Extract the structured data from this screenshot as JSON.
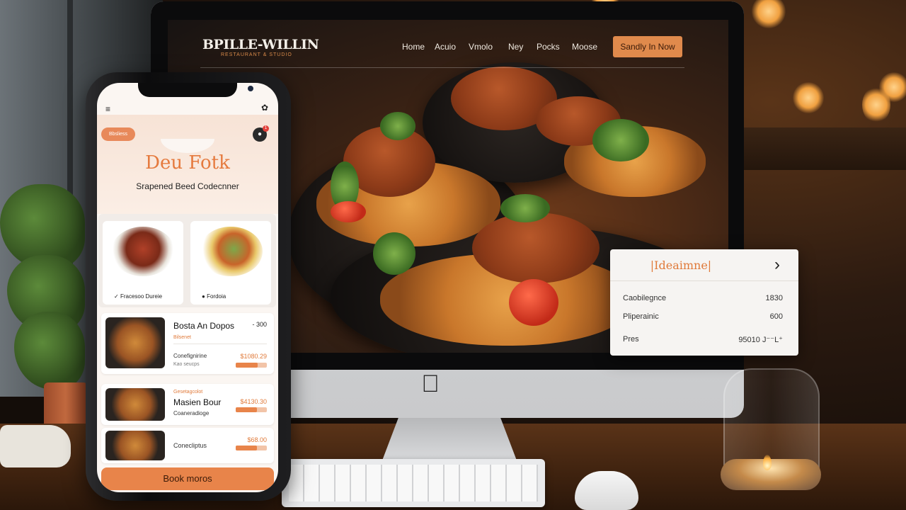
{
  "website": {
    "brand": "BPILLE-WILLIN",
    "brand_tagline": "RESTAURANT & STUDIO",
    "nav": [
      "Home",
      "Acuio",
      "Vmolo",
      "Ney",
      "Pocks",
      "Moose"
    ],
    "cta": "Sandly In Now",
    "info_card": {
      "title": "|Ideaimne|",
      "rows": [
        {
          "label": "Caobilegnce",
          "value": "1830"
        },
        {
          "label": "Pliperainic",
          "value": "600"
        },
        {
          "label": "Pres",
          "value": "95010 J⁻⁻L⁺"
        }
      ]
    }
  },
  "mobile_app": {
    "badge": "Bbsliess",
    "cart_count": "1",
    "hero_title": "Deu Fotk",
    "hero_subtitle": "Srapened Beed Codecnner",
    "featured": [
      {
        "caption": "Fracesoo Dureie",
        "icon": "check-icon"
      },
      {
        "caption": "Fordoia",
        "icon": "dot-icon"
      }
    ],
    "menu_items": [
      {
        "title": "Bosta An Dopos",
        "tag": "Bilsenet",
        "subtitle": "Conefignirine",
        "note": "Kao seucps",
        "price_top": "- 300",
        "price_bottom": "$1080.29",
        "bar_fill": 0.7
      },
      {
        "title": "Masien Bour",
        "tag": "Gesetagcolot",
        "subtitle": "Coaneradioge",
        "note": "",
        "price_top": "",
        "price_bottom": "$4130.30",
        "bar_fill": 0.68
      },
      {
        "title": "Conecliptus",
        "tag": "",
        "subtitle": "",
        "note": "",
        "price_top": "",
        "price_bottom": "$68.00",
        "bar_fill": 0.68
      }
    ],
    "book_button": "Book moros"
  },
  "colors": {
    "accent": "#e8844a",
    "dark": "#111111",
    "card_bg": "#f6f4f2"
  }
}
